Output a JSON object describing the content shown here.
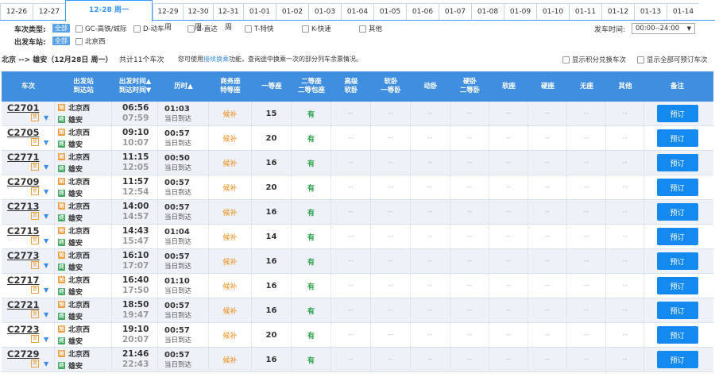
{
  "date_tabs": [
    "12-26",
    "12-27",
    "12-28 周一",
    "12-29 周",
    "12-30 周",
    "12-31 周",
    "01-01",
    "01-02",
    "01-03",
    "01-04",
    "01-05",
    "01-06",
    "01-07",
    "01-08",
    "01-09",
    "01-10",
    "01-11",
    "01-12",
    "01-13",
    "01-14"
  ],
  "active_tab_index": 2,
  "filters": {
    "train_type_label": "车次类型:",
    "all_label": "全部",
    "train_types": [
      "GC-高铁/城际",
      "D-动车",
      "Z-直达",
      "T-特快",
      "K-快速",
      "其他"
    ],
    "station_label": "出发车站:",
    "stations": [
      "北京西"
    ],
    "depart_time_label": "发车时间:",
    "depart_time_value": "00:00--24:00"
  },
  "summary": {
    "route": "北京 --> 雄安（12月28日 周一）",
    "count_text": "共计11个车次",
    "hint_before": "您可使用",
    "hint_link": "接续换乘",
    "hint_after": "功能，查询途中换乘一次的部分列车余票情况。",
    "opt_points": "显示积分兑换车次",
    "opt_bookable": "显示全部可预订车次"
  },
  "table_headers": {
    "train": "车次",
    "station_1": "出发站",
    "station_2": "到达站",
    "time_1": "出发时间▲",
    "time_2": "到达时间▼",
    "duration": "历时▲",
    "business_1": "商务座",
    "business_2": "特等座",
    "first": "一等座",
    "second_1": "二等座",
    "second_2": "二等包座",
    "soft_sleeper_hi_1": "高级",
    "soft_sleeper_hi_2": "软卧",
    "soft_sleeper_1": "软卧",
    "soft_sleeper_2": "一等卧",
    "dong_sleeper": "动卧",
    "hard_sleeper_1": "硬卧",
    "hard_sleeper_2": "二等卧",
    "soft_seat": "软座",
    "hard_seat": "硬座",
    "no_seat": "无座",
    "other": "其他",
    "remark": "备注"
  },
  "rows": [
    {
      "train": "C2701",
      "from": "北京西",
      "to": "雄安",
      "dep": "06:56",
      "arr": "07:59",
      "dur": "01:03",
      "day": "当日到达",
      "business": "候补",
      "first": "15",
      "second": "有"
    },
    {
      "train": "C2705",
      "from": "北京西",
      "to": "雄安",
      "dep": "09:10",
      "arr": "10:07",
      "dur": "00:57",
      "day": "当日到达",
      "business": "候补",
      "first": "20",
      "second": "有"
    },
    {
      "train": "C2771",
      "from": "北京西",
      "to": "雄安",
      "dep": "11:15",
      "arr": "12:05",
      "dur": "00:50",
      "day": "当日到达",
      "business": "候补",
      "first": "16",
      "second": "有"
    },
    {
      "train": "C2709",
      "from": "北京西",
      "to": "雄安",
      "dep": "11:57",
      "arr": "12:54",
      "dur": "00:57",
      "day": "当日到达",
      "business": "候补",
      "first": "20",
      "second": "有"
    },
    {
      "train": "C2713",
      "from": "北京西",
      "to": "雄安",
      "dep": "14:00",
      "arr": "14:57",
      "dur": "00:57",
      "day": "当日到达",
      "business": "候补",
      "first": "16",
      "second": "有"
    },
    {
      "train": "C2715",
      "from": "北京西",
      "to": "雄安",
      "dep": "14:43",
      "arr": "15:47",
      "dur": "01:04",
      "day": "当日到达",
      "business": "候补",
      "first": "14",
      "second": "有"
    },
    {
      "train": "C2773",
      "from": "北京西",
      "to": "雄安",
      "dep": "16:10",
      "arr": "17:07",
      "dur": "00:57",
      "day": "当日到达",
      "business": "候补",
      "first": "16",
      "second": "有"
    },
    {
      "train": "C2717",
      "from": "北京西",
      "to": "雄安",
      "dep": "16:40",
      "arr": "17:50",
      "dur": "01:10",
      "day": "当日到达",
      "business": "候补",
      "first": "16",
      "second": "有"
    },
    {
      "train": "C2721",
      "from": "北京西",
      "to": "雄安",
      "dep": "18:50",
      "arr": "19:47",
      "dur": "00:57",
      "day": "当日到达",
      "business": "候补",
      "first": "16",
      "second": "有"
    },
    {
      "train": "C2723",
      "from": "北京西",
      "to": "雄安",
      "dep": "19:10",
      "arr": "20:07",
      "dur": "00:57",
      "day": "当日到达",
      "business": "候补",
      "first": "20",
      "second": "有"
    },
    {
      "train": "C2729",
      "from": "北京西",
      "to": "雄安",
      "dep": "21:46",
      "arr": "22:43",
      "dur": "00:57",
      "day": "当日到达",
      "business": "候补",
      "first": "16",
      "second": "有"
    }
  ],
  "labels": {
    "dash": "--",
    "book": "预订",
    "badge_start": "始",
    "badge_end": "终",
    "badge_fu": "复",
    "arrow_down": "▼"
  },
  "colors": {
    "accent": "#3f8ee0",
    "book_button": "#1489ef",
    "waitlist": "#f28c12",
    "available": "#2aa24a"
  }
}
